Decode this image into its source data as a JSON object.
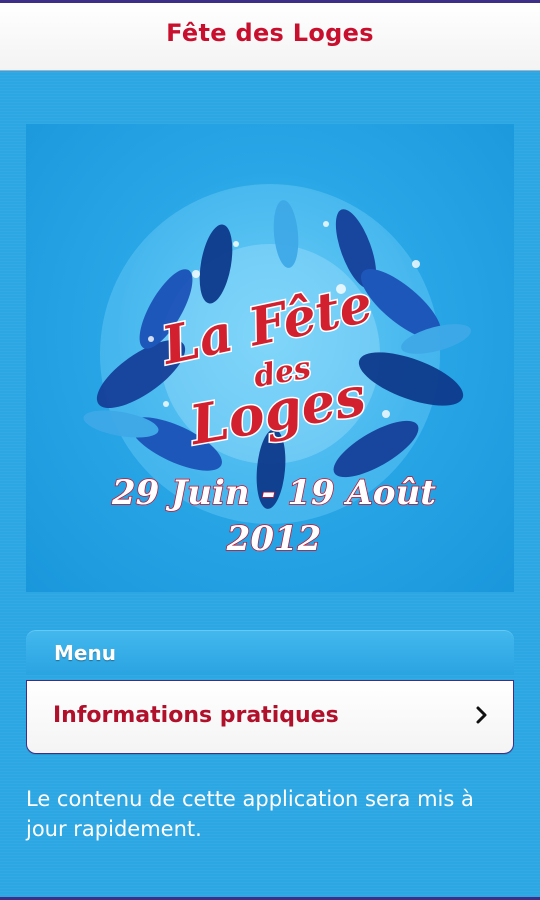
{
  "header": {
    "title": "Fête des Loges"
  },
  "poster": {
    "logo_line1": "La Fête",
    "logo_line2": "des",
    "logo_line3": "Loges",
    "dates": "29 Juin - 19 Août",
    "year": "2012"
  },
  "menu": {
    "section_label": "Menu",
    "items": [
      {
        "label": "Informations pratiques",
        "icon": "chevron-right-icon"
      }
    ]
  },
  "notice": "Le contenu de cette application sera mis à jour rapidement.",
  "colors": {
    "background": "#2ca7e3",
    "accent_red": "#c8102e",
    "border_purple": "#3d2f88"
  }
}
